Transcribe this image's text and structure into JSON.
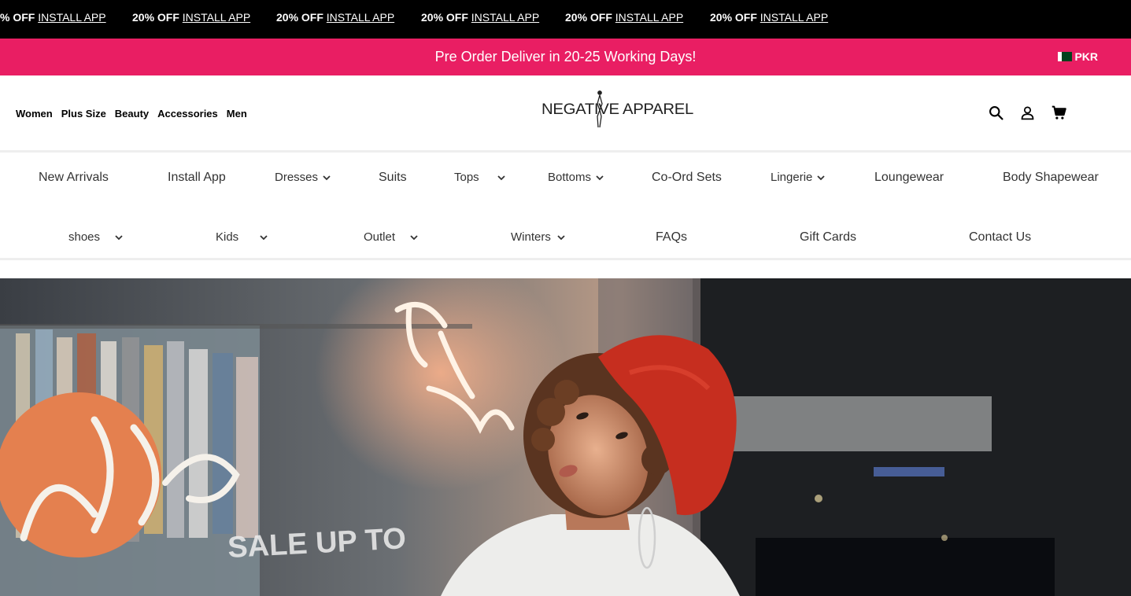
{
  "ticker": {
    "items": [
      {
        "offer": "% OFF",
        "link": "INSTALL APP"
      },
      {
        "offer": "20% OFF",
        "link": "INSTALL APP"
      },
      {
        "offer": "20% OFF",
        "link": "INSTALL APP"
      },
      {
        "offer": "20% OFF",
        "link": "INSTALL APP"
      },
      {
        "offer": "20% OFF",
        "link": "INSTALL APP"
      },
      {
        "offer": "20% OFF",
        "link": "INSTALL APP"
      }
    ]
  },
  "promo": {
    "message": "Pre Order Deliver in 20-25 Working Days!",
    "currency": "PKR"
  },
  "header": {
    "nav": [
      "Women",
      "Plus Size",
      "Beauty",
      "Accessories",
      "Men"
    ],
    "logo_text": "NEGATIVE APPAREL",
    "icons": [
      "search-icon",
      "account-icon",
      "cart-icon"
    ]
  },
  "menu": {
    "items": [
      {
        "label": "New Arrivals"
      },
      {
        "label": "Install App"
      },
      {
        "label": "Dresses",
        "dropdown": true
      },
      {
        "label": "Suits"
      },
      {
        "label": "Tops",
        "dropdown": true
      },
      {
        "label": "Bottoms",
        "dropdown": true
      },
      {
        "label": "Co-Ord Sets"
      },
      {
        "label": "Lingerie",
        "dropdown": true
      },
      {
        "label": "Loungewear"
      },
      {
        "label": "Body Shapewear"
      },
      {
        "label": "shoes",
        "dropdown": true
      },
      {
        "label": "Kids",
        "dropdown": true
      },
      {
        "label": "Outlet",
        "dropdown": true
      },
      {
        "label": "Winters",
        "dropdown": true
      },
      {
        "label": "FAQs"
      },
      {
        "label": "Gift Cards"
      },
      {
        "label": "Contact Us"
      }
    ]
  },
  "hero": {
    "sign_text": "SALE UP TO"
  },
  "colors": {
    "promo_bg": "#e91e63",
    "ticker_bg": "#000000",
    "menu_text": "#333333"
  }
}
